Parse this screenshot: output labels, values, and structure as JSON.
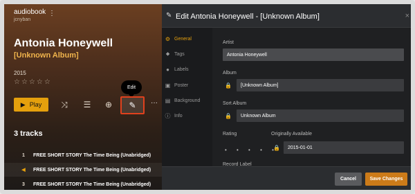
{
  "app": {
    "user_name": "audiobook",
    "user_handle": "jcnyban",
    "more_icon": "⋮"
  },
  "album": {
    "title": "Antonia Honeywell",
    "subtitle": "[Unknown Album]",
    "year": "2015",
    "rating_stars": "☆☆☆☆☆"
  },
  "toolbar": {
    "play_label": "Play",
    "edit_tooltip": "Edit",
    "more": "···"
  },
  "tracks": {
    "heading": "3 tracks",
    "items": [
      {
        "num": "1",
        "title": "FREE SHORT STORY The Time Being (Unabridged)"
      },
      {
        "num": "◀",
        "title": "FREE SHORT STORY The Time Being (Unabridged)"
      },
      {
        "num": "3",
        "title": "FREE SHORT STORY The Time Being (Unabridged)"
      }
    ]
  },
  "dialog": {
    "title": "Edit Antonia Honeywell - [Unknown Album]",
    "close": "×",
    "nav": [
      {
        "label": "General",
        "icon": "gear-icon"
      },
      {
        "label": "Tags",
        "icon": "tag-icon"
      },
      {
        "label": "Labels",
        "icon": "users-icon"
      },
      {
        "label": "Poster",
        "icon": "image-icon"
      },
      {
        "label": "Background",
        "icon": "background-image-icon"
      },
      {
        "label": "Info",
        "icon": "info-icon"
      }
    ],
    "fields": {
      "artist_label": "Artist",
      "artist_value": "Antonia Honeywell",
      "album_label": "Album",
      "album_value": "[Unknown Album]",
      "sort_album_label": "Sort Album",
      "sort_album_value": "Unknown Album",
      "rating_label": "Rating",
      "rating_value": "• • • • •",
      "originally_available_label": "Originally Available",
      "originally_available_value": "2015-01-01",
      "record_label_label": "Record Label"
    },
    "buttons": {
      "cancel": "Cancel",
      "save": "Save Changes"
    }
  },
  "colors": {
    "accent": "#e5a00d",
    "highlight": "#e0411d",
    "save": "#cc7b19"
  }
}
